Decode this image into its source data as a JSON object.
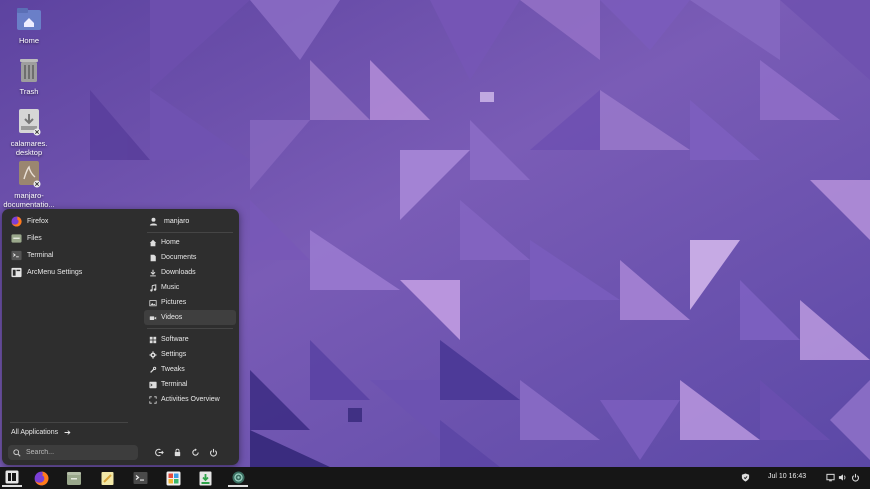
{
  "desktop": {
    "icons": [
      {
        "label": "Home",
        "icon": "folder-home-icon"
      },
      {
        "label": "Trash",
        "icon": "trash-icon"
      },
      {
        "label": "calamares.\ndesktop",
        "icon": "desktop-file-icon"
      },
      {
        "label": "manjaro-\ndocumentatio...",
        "icon": "pdf-file-icon"
      }
    ]
  },
  "arcmenu": {
    "apps": [
      {
        "label": "Firefox",
        "icon": "firefox-icon"
      },
      {
        "label": "Files",
        "icon": "files-icon"
      },
      {
        "label": "Terminal",
        "icon": "terminal-icon"
      },
      {
        "label": "ArcMenu Settings",
        "icon": "arcmenu-settings-icon"
      }
    ],
    "all_apps_label": "All Applications",
    "search_placeholder": "Search...",
    "user_name": "manjaro",
    "places": [
      {
        "label": "Home",
        "icon": "home-icon"
      },
      {
        "label": "Documents",
        "icon": "document-icon"
      },
      {
        "label": "Downloads",
        "icon": "download-icon"
      },
      {
        "label": "Music",
        "icon": "music-icon"
      },
      {
        "label": "Pictures",
        "icon": "picture-icon"
      },
      {
        "label": "Videos",
        "icon": "video-icon"
      }
    ],
    "system": [
      {
        "label": "Software",
        "icon": "software-icon"
      },
      {
        "label": "Settings",
        "icon": "settings-icon"
      },
      {
        "label": "Tweaks",
        "icon": "tweaks-icon"
      },
      {
        "label": "Terminal",
        "icon": "terminal-icon"
      },
      {
        "label": "Activities Overview",
        "icon": "activities-icon"
      }
    ],
    "selected_place": "Videos"
  },
  "taskbar": {
    "clock": "Jul 10  16:43",
    "apps": [
      "arcmenu-icon",
      "firefox-icon",
      "files-icon",
      "text-editor-icon",
      "terminal-icon",
      "software-icon",
      "installer-icon",
      "settings-icon"
    ]
  },
  "colors": {
    "menu_bg": "#2e2e2e",
    "taskbar_bg": "#161616",
    "wallpaper": "#6a4fa8"
  }
}
